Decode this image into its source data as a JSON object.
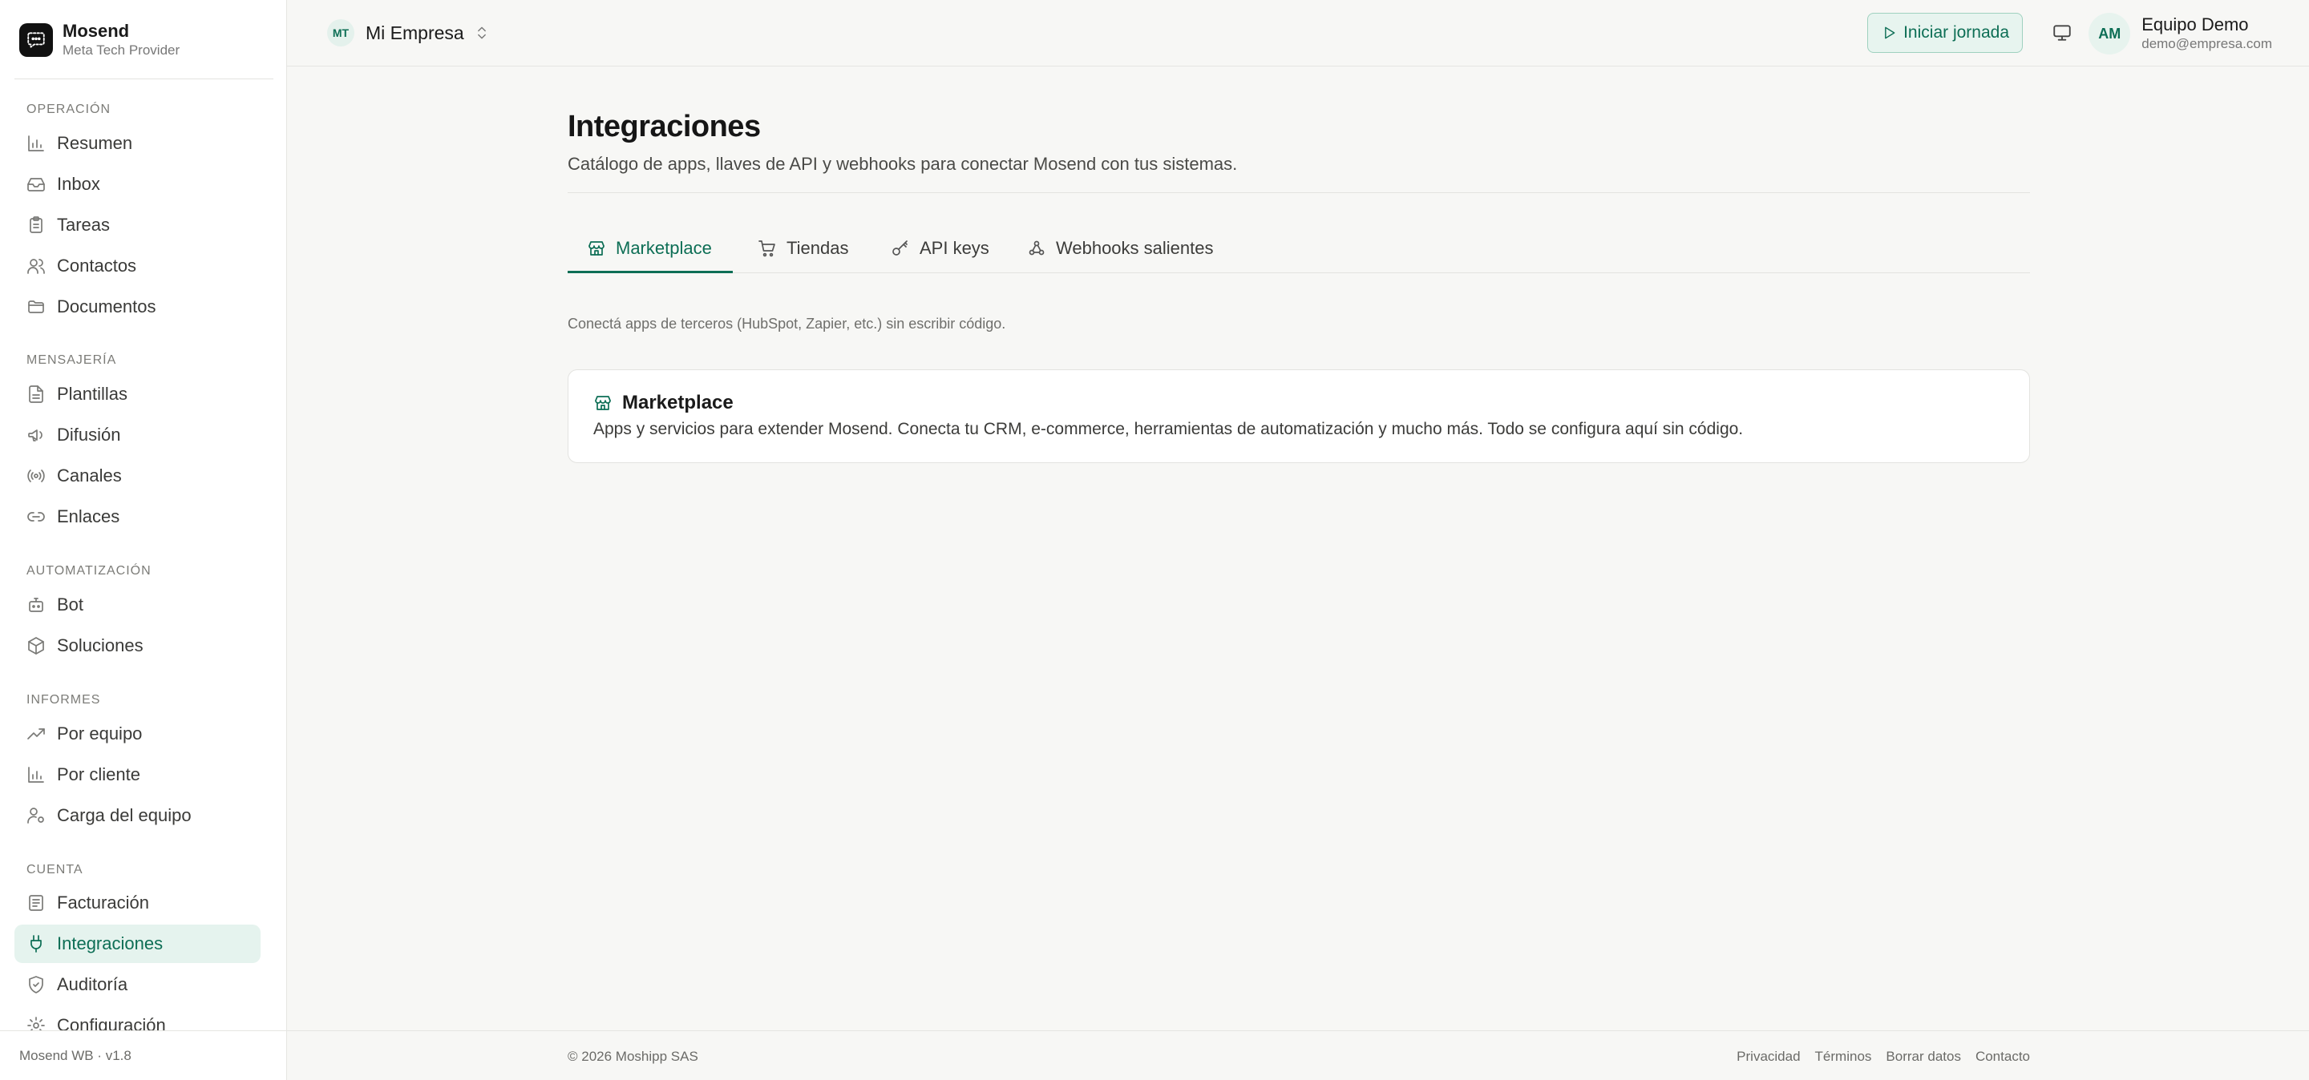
{
  "brand": {
    "name": "Mosend",
    "subtitle": "Meta Tech Provider"
  },
  "sidebar": {
    "sections": [
      {
        "title": "OPERACIÓN",
        "items": [
          {
            "label": "Resumen",
            "icon": "bar-chart-icon"
          },
          {
            "label": "Inbox",
            "icon": "inbox-icon"
          },
          {
            "label": "Tareas",
            "icon": "clipboard-icon"
          },
          {
            "label": "Contactos",
            "icon": "users-icon"
          },
          {
            "label": "Documentos",
            "icon": "folder-icon"
          }
        ]
      },
      {
        "title": "MENSAJERÍA",
        "items": [
          {
            "label": "Plantillas",
            "icon": "file-text-icon"
          },
          {
            "label": "Difusión",
            "icon": "megaphone-icon"
          },
          {
            "label": "Canales",
            "icon": "radio-icon"
          },
          {
            "label": "Enlaces",
            "icon": "link-icon"
          }
        ]
      },
      {
        "title": "AUTOMATIZACIÓN",
        "items": [
          {
            "label": "Bot",
            "icon": "bot-icon"
          },
          {
            "label": "Soluciones",
            "icon": "package-icon"
          }
        ]
      },
      {
        "title": "INFORMES",
        "items": [
          {
            "label": "Por equipo",
            "icon": "trending-up-icon"
          },
          {
            "label": "Por cliente",
            "icon": "bar-chart-icon"
          },
          {
            "label": "Carga del equipo",
            "icon": "user-cog-icon"
          }
        ]
      },
      {
        "title": "CUENTA",
        "items": [
          {
            "label": "Facturación",
            "icon": "receipt-icon"
          },
          {
            "label": "Integraciones",
            "icon": "plug-icon",
            "active": true
          },
          {
            "label": "Auditoría",
            "icon": "shield-icon"
          },
          {
            "label": "Configuración",
            "icon": "settings-icon"
          }
        ]
      }
    ],
    "footer": "Mosend WB · v1.8"
  },
  "header": {
    "org_initials": "MT",
    "org_name": "Mi Empresa",
    "start_button": "Iniciar jornada",
    "user_initials": "AM",
    "user_name": "Equipo Demo",
    "user_email": "demo@empresa.com"
  },
  "main": {
    "title": "Integraciones",
    "subtitle": "Catálogo de apps, llaves de API y webhooks para conectar Mosend con tus sistemas.",
    "tabs": [
      {
        "label": "Marketplace",
        "icon": "store-icon",
        "active": true
      },
      {
        "label": "Tiendas",
        "icon": "shopping-cart-icon"
      },
      {
        "label": "API keys",
        "icon": "key-icon"
      },
      {
        "label": "Webhooks salientes",
        "icon": "webhook-icon"
      }
    ],
    "helper": "Conectá apps de terceros (HubSpot, Zapier, etc.) sin escribir código.",
    "card": {
      "title": "Marketplace",
      "description": "Apps y servicios para extender Mosend. Conecta tu CRM, e-commerce, herramientas de automatización y mucho más. Todo se configura aquí sin código."
    }
  },
  "footer": {
    "copyright": "© 2026 Moshipp SAS",
    "links": [
      "Privacidad",
      "Términos",
      "Borrar datos",
      "Contacto"
    ]
  },
  "colors": {
    "accent": "#0d6e55",
    "accent_bg": "#e5f3ee",
    "background": "#f7f7f5"
  }
}
